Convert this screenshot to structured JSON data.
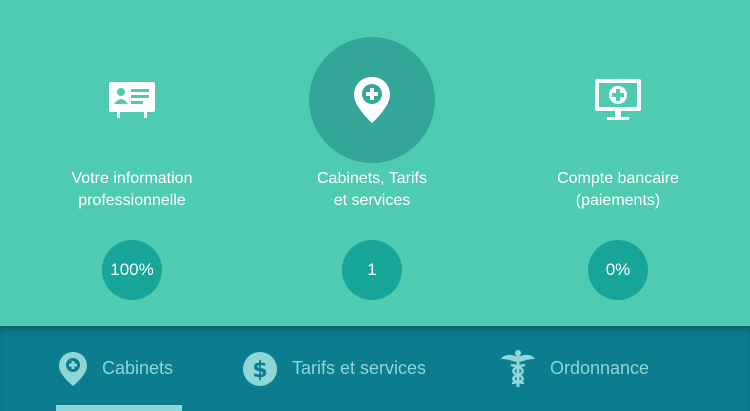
{
  "steps": [
    {
      "label_line1": "Votre information",
      "label_line2": "professionnelle",
      "badge": "100%",
      "icon": "id-card-icon"
    },
    {
      "label_line1": "Cabinets, Tarifs",
      "label_line2": "et services",
      "badge": "1",
      "icon": "location-pin-plus-icon",
      "active": true
    },
    {
      "label_line1": "Compte bancaire",
      "label_line2": "(paiements)",
      "badge": "0%",
      "icon": "monitor-plus-icon"
    }
  ],
  "tabs": [
    {
      "label": "Cabinets",
      "icon": "location-pin-plus-icon",
      "active": true
    },
    {
      "label": "Tarifs et services",
      "icon": "dollar-coin-icon"
    },
    {
      "label": "Ordonnance",
      "icon": "caduceus-icon"
    }
  ],
  "colors": {
    "background": "#4ecbb1",
    "active_circle": "#33a697",
    "badge": "#16a598",
    "bottom_bar": "#0b7d8f",
    "tab_text": "#8fd6d6"
  }
}
